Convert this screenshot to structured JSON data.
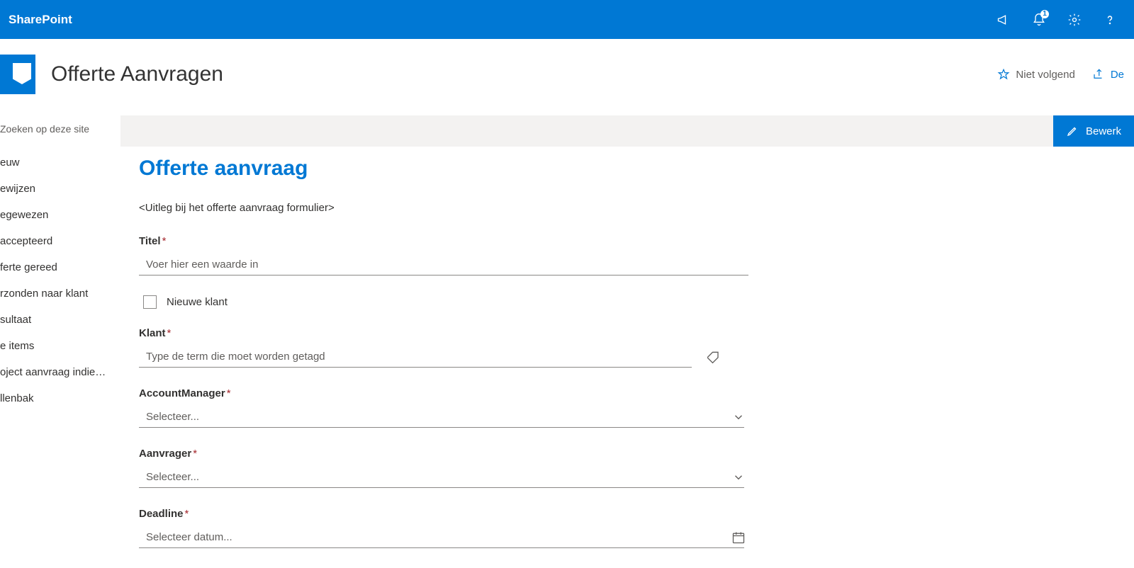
{
  "suite": {
    "brand": "SharePoint",
    "notification_count": "1"
  },
  "site": {
    "title": "Offerte Aanvragen",
    "follow_label": "Niet volgend",
    "share_label": "De"
  },
  "search": {
    "placeholder": "Zoeken op deze site"
  },
  "nav": {
    "items": [
      "euw",
      "ewijzen",
      "egewezen",
      "accepteerd",
      "ferte gereed",
      "rzonden naar klant",
      "sultaat",
      "e items",
      "oject aanvraag indie…",
      "llenbak"
    ]
  },
  "command": {
    "edit_label": "Bewerk"
  },
  "form": {
    "title": "Offerte aanvraag",
    "description": "<Uitleg bij het offerte aanvraag formulier>",
    "fields": {
      "titel": {
        "label": "Titel",
        "placeholder": "Voer hier een waarde in"
      },
      "nieuwe_klant": {
        "label": "Nieuwe klant"
      },
      "klant": {
        "label": "Klant",
        "placeholder": "Type de term die moet worden getagd"
      },
      "account_manager": {
        "label": "AccountManager",
        "placeholder": "Selecteer..."
      },
      "aanvrager": {
        "label": "Aanvrager",
        "placeholder": "Selecteer..."
      },
      "deadline": {
        "label": "Deadline",
        "placeholder": "Selecteer datum..."
      }
    },
    "required_mark": "*"
  }
}
